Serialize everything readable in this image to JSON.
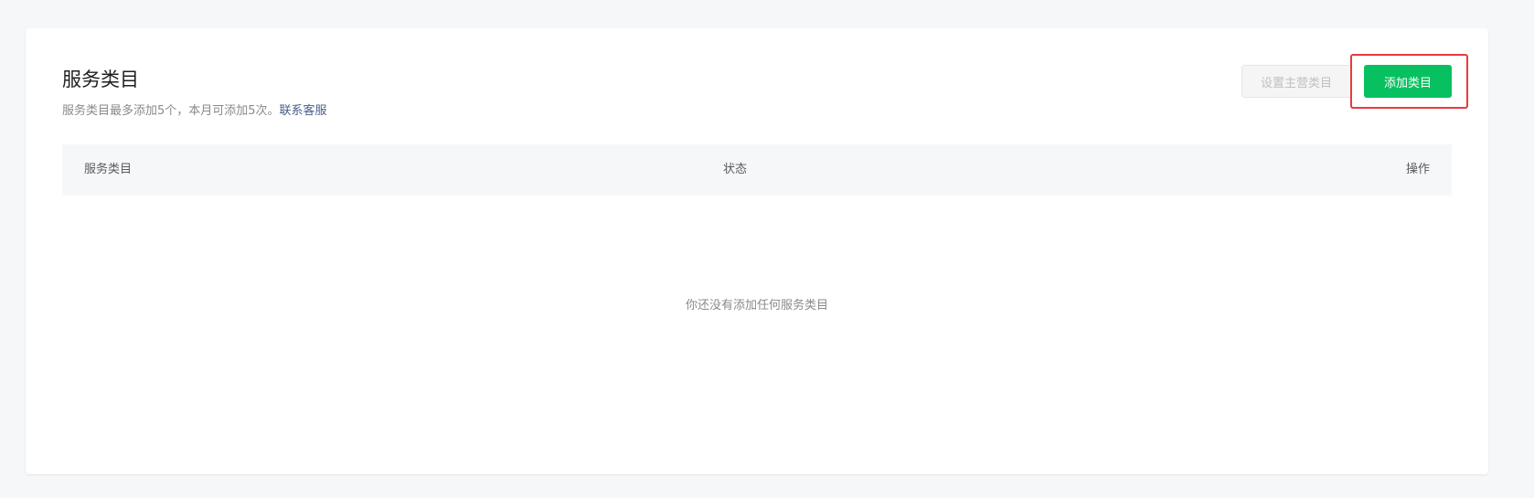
{
  "section": {
    "title": "服务类目",
    "description": "服务类目最多添加5个，本月可添加5次。",
    "contact_link": "联系客服"
  },
  "actions": {
    "set_main_label": "设置主营类目",
    "add_label": "添加类目"
  },
  "table": {
    "columns": [
      "服务类目",
      "状态",
      "操作"
    ],
    "empty_text": "你还没有添加任何服务类目"
  },
  "colors": {
    "primary": "#07c160",
    "link": "#4a5c8b",
    "highlight": "#ea3a3a"
  }
}
